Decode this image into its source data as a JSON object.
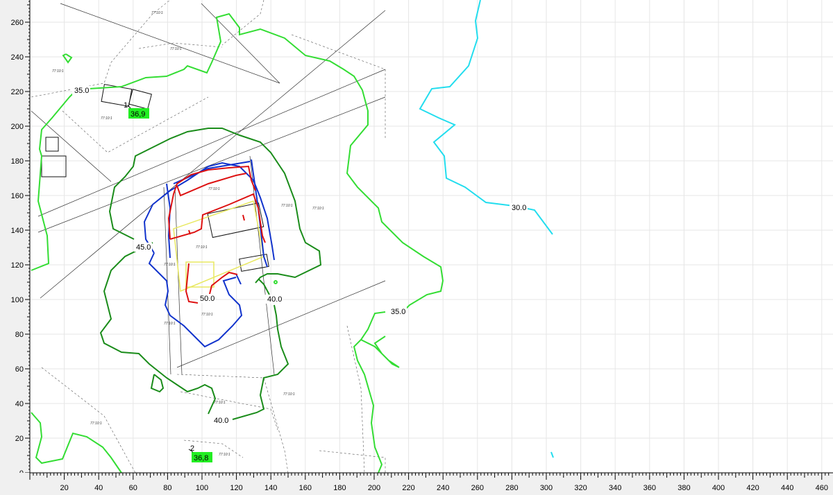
{
  "map": {
    "x_axis": {
      "ticks": [
        "20",
        "40",
        "60",
        "80",
        "100",
        "120",
        "140",
        "160",
        "180",
        "200",
        "220",
        "240",
        "260",
        "280",
        "300",
        "320",
        "340",
        "360",
        "380",
        "400",
        "420",
        "440",
        "460"
      ]
    },
    "y_axis": {
      "ticks": [
        "0",
        "20",
        "40",
        "60",
        "80",
        "100",
        "120",
        "140",
        "160",
        "180",
        "200",
        "220",
        "240",
        "260"
      ]
    },
    "contour_labels": [
      {
        "text": "35.0",
        "color": "#33dd33"
      },
      {
        "text": "35.0",
        "color": "#33dd33"
      },
      {
        "text": "45.0",
        "color": "#1a8c1a"
      },
      {
        "text": "50.0",
        "color": "#cc0000"
      },
      {
        "text": "40.0",
        "color": "#1a8c1a"
      },
      {
        "text": "40.0",
        "color": "#1a8c1a"
      },
      {
        "text": "30.0",
        "color": "#22ddee"
      }
    ],
    "point_values": [
      {
        "id": "1",
        "value": "36,9"
      },
      {
        "id": "2",
        "value": "36,8"
      }
    ],
    "colors": {
      "contour_30": "#22ddee",
      "contour_35": "#33dd33",
      "contour_40": "#1a8c1a",
      "contour_45": "#1133cc",
      "contour_50": "#dd1111",
      "point_highlight": "#22ee22",
      "axis_background": "#f0f0f0"
    }
  }
}
